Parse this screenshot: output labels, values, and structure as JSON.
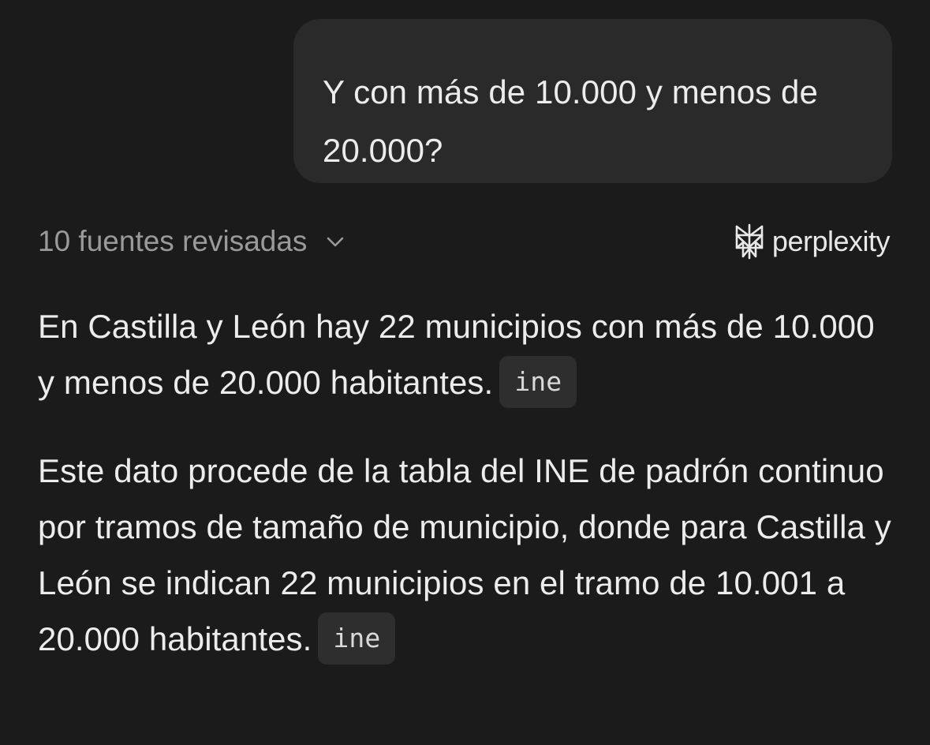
{
  "user_message": {
    "text": "Y con más de 10.000 y menos de 20.000?"
  },
  "sources": {
    "label": "10 fuentes revisadas"
  },
  "brand": {
    "name": "perplexity",
    "icon": "perplexity-logo-icon"
  },
  "answer": {
    "paragraph_1": "En Castilla y León hay 22 municipios con más de 10.000 y menos de 20.000 habitantes.",
    "citation_1": "ine",
    "paragraph_2": "Este dato procede de la tabla del INE de padrón continuo por tramos de tamaño de municipio, donde para Castilla y León se indican 22 municipios en el tramo de 10.001 a 20.000 habitantes.",
    "citation_2": "ine"
  },
  "colors": {
    "background": "#1b1b1b",
    "bubble": "#2a2a2b",
    "text": "#ececec",
    "muted_text": "#9a9a9a",
    "chip": "#2e2e2e"
  }
}
